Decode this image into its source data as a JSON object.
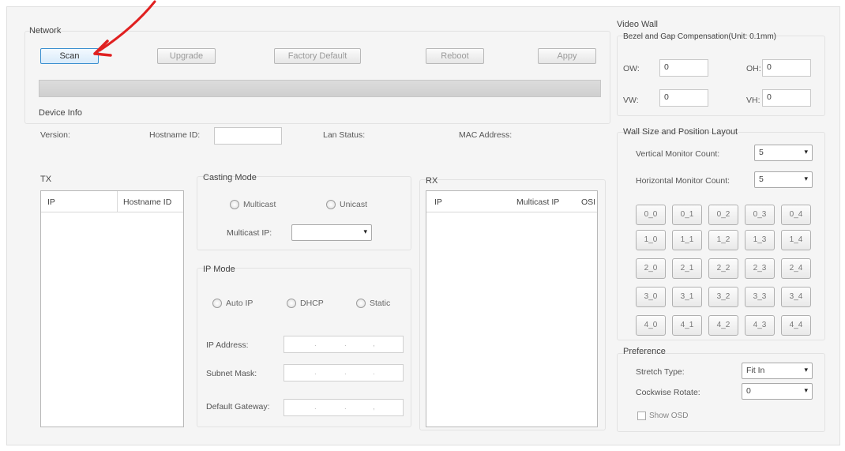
{
  "network": {
    "title": "Network",
    "buttons": {
      "scan": "Scan",
      "upgrade": "Upgrade",
      "factory_default": "Factory Default",
      "reboot": "Reboot",
      "apply": "Appy"
    }
  },
  "device_info": {
    "title": "Device Info",
    "version_label": "Version:",
    "hostname_label": "Hostname ID:",
    "hostname_value": "",
    "lan_status_label": "Lan Status:",
    "mac_label": "MAC Address:"
  },
  "tx": {
    "title": "TX",
    "columns": [
      "IP",
      "Hostname ID"
    ]
  },
  "casting_mode": {
    "title": "Casting Mode",
    "multicast_label": "Multicast",
    "unicast_label": "Unicast",
    "multicast_ip_label": "Multicast IP:",
    "multicast_ip_value": ""
  },
  "ip_mode": {
    "title": "IP Mode",
    "auto_ip": "Auto IP",
    "dhcp": "DHCP",
    "static": "Static",
    "ip_address_label": "IP Address:",
    "subnet_mask_label": "Subnet Mask:",
    "default_gateway_label": "Default Gateway:"
  },
  "rx": {
    "title": "RX",
    "columns": [
      "IP",
      "Multicast IP",
      "OSI"
    ]
  },
  "video_wall": {
    "title": "Video Wall",
    "bezel_title": "Bezel and Gap Compensation(Unit: 0.1mm)",
    "ow_label": "OW:",
    "ow_value": "0",
    "oh_label": "OH:",
    "oh_value": "0",
    "vw_label": "VW:",
    "vw_value": "0",
    "vh_label": "VH:",
    "vh_value": "0"
  },
  "wall_layout": {
    "title": "Wall Size and Position Layout",
    "vertical_label": "Vertical Monitor Count:",
    "vertical_value": "5",
    "horizontal_label": "Horizontal Monitor Count:",
    "horizontal_value": "5",
    "tiles": [
      [
        "0_0",
        "0_1",
        "0_2",
        "0_3",
        "0_4"
      ],
      [
        "1_0",
        "1_1",
        "1_2",
        "1_3",
        "1_4"
      ],
      [
        "2_0",
        "2_1",
        "2_2",
        "2_3",
        "2_4"
      ],
      [
        "3_0",
        "3_1",
        "3_2",
        "3_3",
        "3_4"
      ],
      [
        "4_0",
        "4_1",
        "4_2",
        "4_3",
        "4_4"
      ]
    ]
  },
  "preference": {
    "title": "Preference",
    "stretch_label": "Stretch Type:",
    "stretch_value": "Fit In",
    "rotate_label": "Cockwise Rotate:",
    "rotate_value": "0",
    "show_osd_label": "Show OSD"
  },
  "colors": {
    "annotation_arrow": "#e02020",
    "scan_focus": "#3a8fd0"
  }
}
